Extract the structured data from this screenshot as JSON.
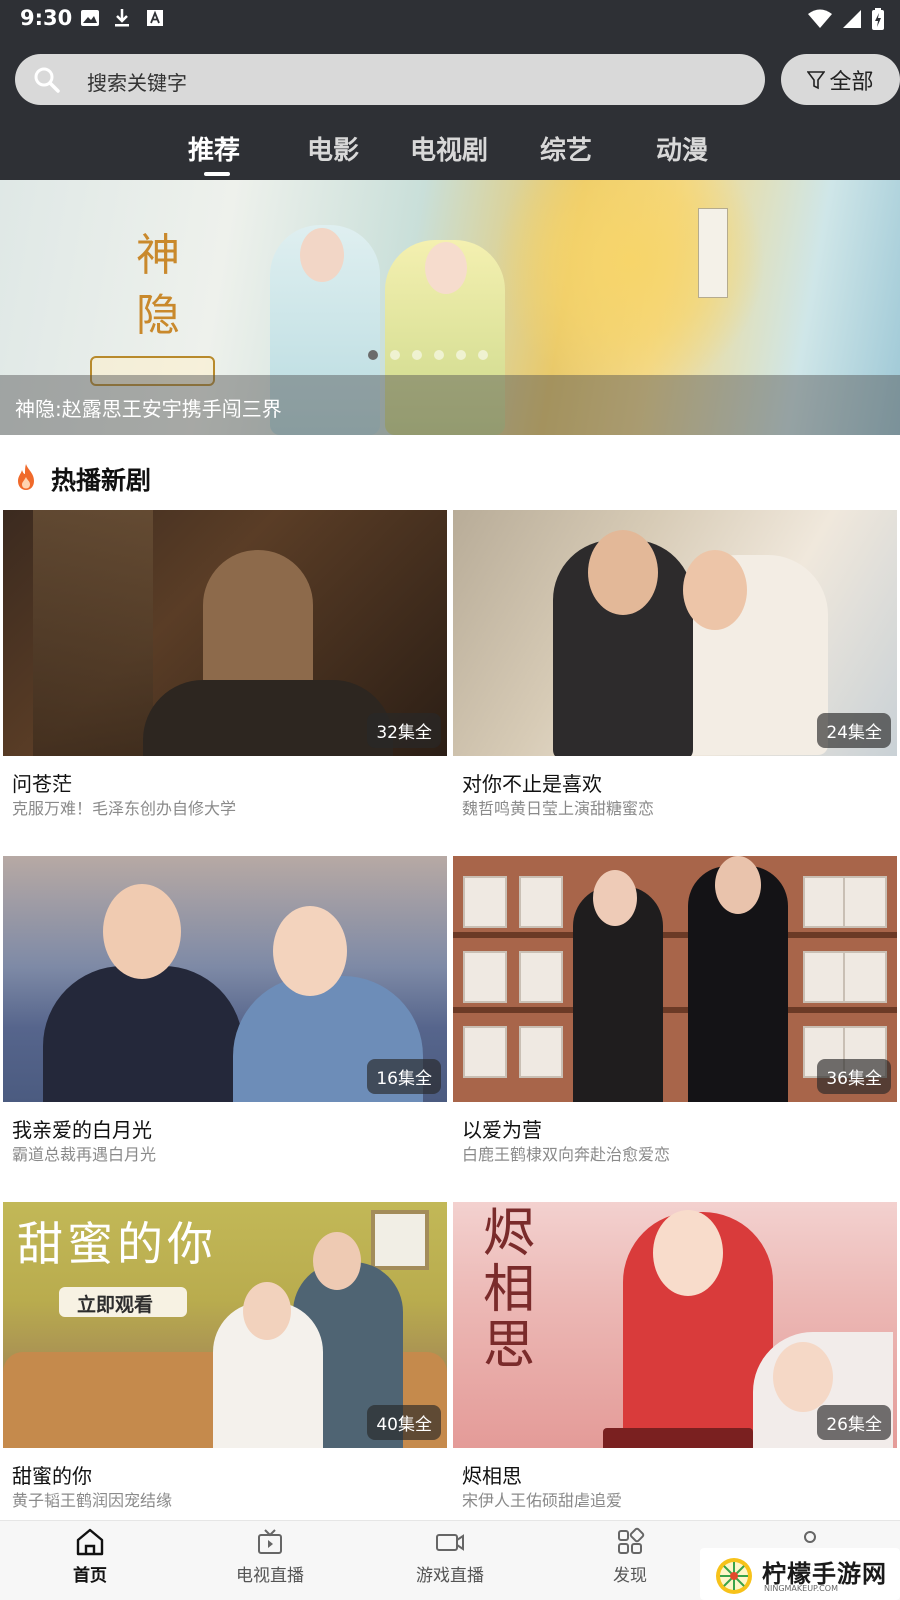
{
  "status_bar": {
    "time": "9:30",
    "left_icons": [
      "image-icon",
      "download-icon",
      "font-icon"
    ],
    "right_icons": [
      "wifi-icon",
      "signal-icon",
      "battery-icon"
    ]
  },
  "search": {
    "placeholder": "搜索关键字",
    "filter_label": "全部"
  },
  "tabs": [
    {
      "label": "推荐",
      "active": true
    },
    {
      "label": "电影",
      "active": false
    },
    {
      "label": "电视剧",
      "active": false
    },
    {
      "label": "综艺",
      "active": false
    },
    {
      "label": "动漫",
      "active": false
    }
  ],
  "banner": {
    "caption": "神隐:赵露思王安宇携手闯三界",
    "logo_text": "神隐",
    "dots_total": 6,
    "dots_active_index": 0
  },
  "section": {
    "title": "热播新剧",
    "icon": "fire-icon"
  },
  "shows": [
    {
      "title": "问苍茫",
      "subtitle": "克服万难！毛泽东创办自修大学",
      "badge": "32集全"
    },
    {
      "title": "对你不止是喜欢",
      "subtitle": "魏哲鸣黄日莹上演甜糖蜜恋",
      "badge": "24集全"
    },
    {
      "title": "我亲爱的白月光",
      "subtitle": "霸道总裁再遇白月光",
      "badge": "16集全"
    },
    {
      "title": "以爱为营",
      "subtitle": "白鹿王鹤棣双向奔赴治愈爱恋",
      "badge": "36集全"
    },
    {
      "title": "甜蜜的你",
      "subtitle": "黄子韬王鹤润因宠结缘",
      "badge": "40集全",
      "poster_text": "甜蜜的你",
      "poster_button": "立即观看"
    },
    {
      "title": "烬相思",
      "subtitle": "宋伊人王佑硕甜虐追爱",
      "badge": "26集全",
      "poster_text": "烬相思"
    }
  ],
  "bottom_nav": [
    {
      "label": "首页",
      "icon": "home-icon",
      "active": true
    },
    {
      "label": "电视直播",
      "icon": "tv-icon",
      "active": false
    },
    {
      "label": "游戏直播",
      "icon": "video-camera-icon",
      "active": false
    },
    {
      "label": "发现",
      "icon": "grid-icon",
      "active": false
    },
    {
      "label": "",
      "icon": "user-icon",
      "active": false
    }
  ],
  "watermark": {
    "text": "柠檬手游网",
    "url": "NINGMAKEUP.COM"
  },
  "colors": {
    "header_bg": "#2e3035",
    "search_bg": "#d9d9d9",
    "fire": "#f06a2b"
  }
}
